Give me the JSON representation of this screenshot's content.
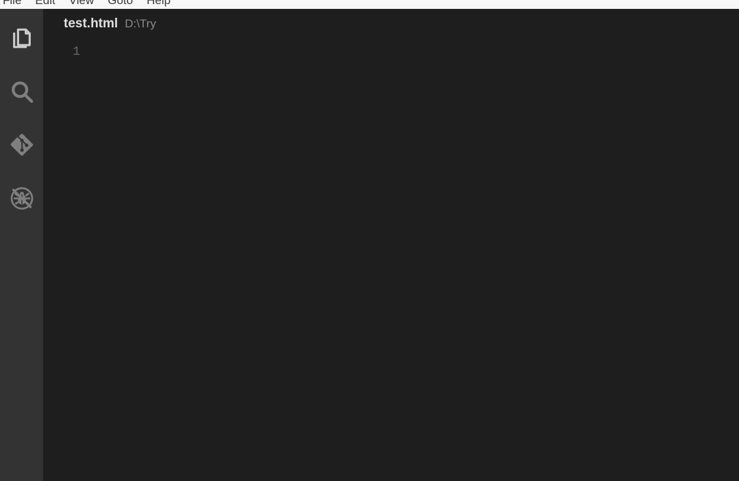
{
  "menubar": {
    "items": [
      "File",
      "Edit",
      "View",
      "Goto",
      "Help"
    ]
  },
  "activitybar": {
    "icons": [
      {
        "name": "files-icon",
        "active": true
      },
      {
        "name": "search-icon",
        "active": false
      },
      {
        "name": "git-icon",
        "active": false
      },
      {
        "name": "debug-icon",
        "active": false
      }
    ]
  },
  "editor": {
    "tab": {
      "filename": "test.html",
      "filepath": "D:\\Try"
    },
    "line_numbers": [
      "1"
    ]
  }
}
